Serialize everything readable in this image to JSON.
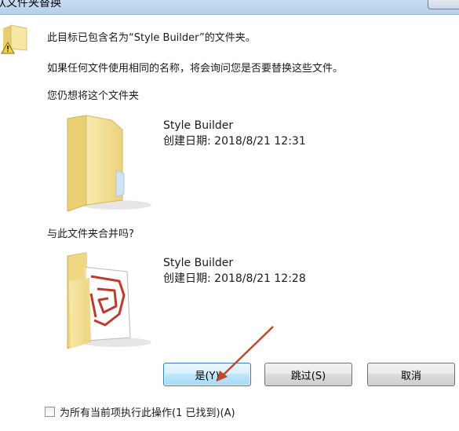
{
  "window": {
    "title": "认文件夹替换"
  },
  "message": {
    "line1": "此目标已包含名为“Style Builder”的文件夹。",
    "line2": "如果任何文件使用相同的名称，将会询问您是否要替换这些文件。",
    "line3": "您仍想将这个文件夹",
    "line4": "与此文件夹合并吗?"
  },
  "existing_folder": {
    "name": "Style Builder",
    "created": "创建日期: 2018/8/21 12:31"
  },
  "incoming_folder": {
    "name": "Style Builder",
    "created": "创建日期: 2018/8/21 12:28"
  },
  "buttons": {
    "yes": "是(Y)",
    "skip": "跳过(S)",
    "cancel": "取消"
  },
  "apply_all": {
    "label": "为所有当前项执行此操作(1 已找到)(A)",
    "checked": false
  },
  "colors": {
    "folder_light": "#f6e7a8",
    "folder_dark": "#e7c86a",
    "annotation_arrow": "#c0462c"
  }
}
